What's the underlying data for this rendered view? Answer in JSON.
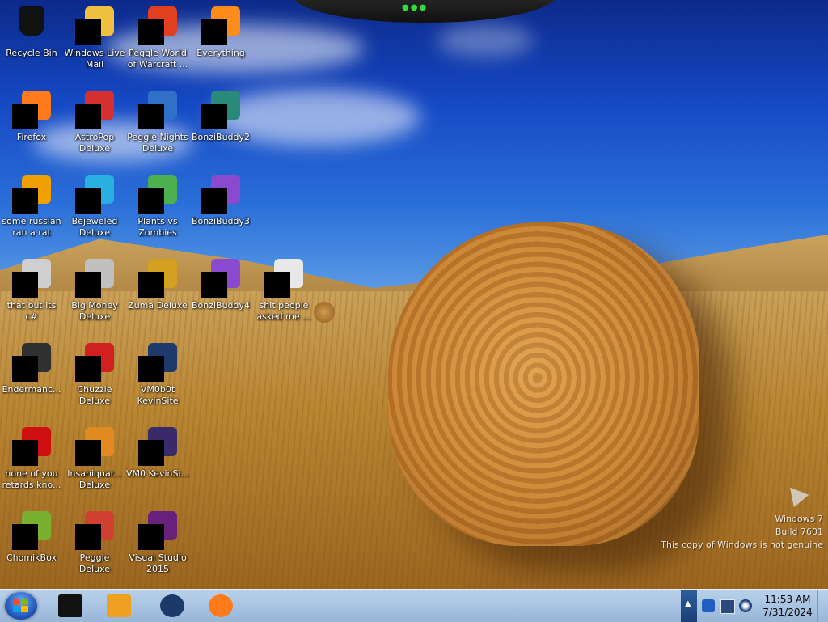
{
  "desktop": {
    "icons": [
      {
        "label": "Recycle Bin",
        "icon": "recycle-bin-icon",
        "color": "#111111"
      },
      {
        "label": "Windows Live Mail",
        "icon": "windows-live-mail-icon",
        "color": "#f0c040"
      },
      {
        "label": "Peggle World of Warcraft ...",
        "icon": "peggle-wow-icon",
        "color": "#e04020"
      },
      {
        "label": "Everything",
        "icon": "everything-search-icon",
        "color": "#ff8c1a"
      },
      {
        "label": "Firefox",
        "icon": "firefox-icon",
        "color": "#ff7a1a"
      },
      {
        "label": "AstroPop Deluxe",
        "icon": "astropop-icon",
        "color": "#d43030"
      },
      {
        "label": "Peggle Nights Deluxe",
        "icon": "peggle-nights-icon",
        "color": "#3070c8"
      },
      {
        "label": "BonziBuddy2",
        "icon": "bonzibuddy-icon",
        "color": "#2a8a7a"
      },
      {
        "label": "some russian ran a rat",
        "icon": "shortcut-icon",
        "color": "#f0a000"
      },
      {
        "label": "Bejeweled Deluxe",
        "icon": "bejeweled-icon",
        "color": "#2ab0e0"
      },
      {
        "label": "Plants vs Zombies",
        "icon": "plants-vs-zombies-icon",
        "color": "#4caf50"
      },
      {
        "label": "BonziBuddy3",
        "icon": "bonzibuddy-icon",
        "color": "#8a4ad0"
      },
      {
        "label": "that but its c#",
        "icon": "windows-stack-icon",
        "color": "#cfcfcf"
      },
      {
        "label": "Big Money Deluxe",
        "icon": "big-money-icon",
        "color": "#c0c0c0"
      },
      {
        "label": "Zuma Deluxe",
        "icon": "zuma-icon",
        "color": "#d4a020"
      },
      {
        "label": "BonziBuddy4",
        "icon": "bonzibuddy-icon",
        "color": "#8a4ad0"
      },
      {
        "label": "shit people asked me ...",
        "icon": "folder-icon",
        "color": "#e8e8e8"
      },
      {
        "label": "Endermanc...",
        "icon": "terminal-icon",
        "color": "#303030"
      },
      {
        "label": "Chuzzle Deluxe",
        "icon": "chuzzle-icon",
        "color": "#d02020"
      },
      {
        "label": "VM0b0t KevinSite",
        "icon": "vm-icon",
        "color": "#1e3a6a"
      },
      {
        "label": "none of you retards kno...",
        "icon": "opera-icon",
        "color": "#d01010"
      },
      {
        "label": "Insaniquar... Deluxe",
        "icon": "insaniquarium-icon",
        "color": "#e08a20"
      },
      {
        "label": "VM0 KevinSi...",
        "icon": "vm-icon",
        "color": "#3a2a6a"
      },
      {
        "label": "ChomikBox",
        "icon": "chomikbox-icon",
        "color": "#7ab030"
      },
      {
        "label": "Peggle Deluxe",
        "icon": "peggle-icon",
        "color": "#d04030"
      },
      {
        "label": "Visual Studio 2015",
        "icon": "visual-studio-icon",
        "color": "#68217a"
      }
    ]
  },
  "watermark": {
    "line1": "Windows 7",
    "line2": "Build 7601",
    "line3": "This copy of Windows is not genuine"
  },
  "taskbar": {
    "pinned": [
      {
        "name": "app-pinned-1",
        "icon": "black-box-icon",
        "color": "#111111"
      },
      {
        "name": "app-pinned-2",
        "icon": "media-player-icon",
        "color": "#f0a020"
      },
      {
        "name": "app-pinned-3",
        "icon": "globe-icon",
        "color": "#1a3a6a"
      },
      {
        "name": "app-pinned-4",
        "icon": "firefox-icon",
        "color": "#ff7a1a"
      }
    ],
    "tray_icons": [
      "network-icon",
      "monitor-icon",
      "volume-icon"
    ],
    "time": "11:53 AM",
    "date": "7/31/2024"
  }
}
